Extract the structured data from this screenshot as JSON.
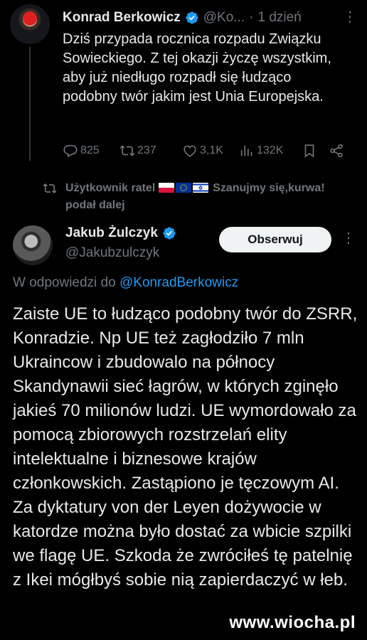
{
  "parent_tweet": {
    "author_name": "Konrad Berkowicz",
    "handle": "@Ko...",
    "separator": "·",
    "time": "1 dzień",
    "text": "Dziś przypada rocznica rozpadu Związku Sowieckiego. Z tej okazji życzę wszystkim, aby już niedługo rozpadł się łudząco podobny twór jakim jest Unia Europejska.",
    "replies": "825",
    "reposts": "237",
    "likes": "3,1K",
    "views": "132K"
  },
  "retweet_indicator": {
    "prefix": "Użytkownik ratel",
    "suffix": "Szanujmy się,kurwa!",
    "line2": "podał dalej",
    "flags": [
      "poland",
      "eu",
      "israel"
    ]
  },
  "main_tweet": {
    "author_name": "Jakub Żulczyk",
    "handle": "@Jakubzulczyk",
    "follow_label": "Obserwuj",
    "reply_prefix": "W odpowiedzi do",
    "reply_handle": "@KonradBerkowicz",
    "text": "Zaiste UE to łudząco podobny twór do ZSRR, Konradzie. Np UE też zagłodziło 7 mln Ukraincow i zbudowalo na północy Skandynawii sieć łagrów, w których zginęło jakieś 70 milionów ludzi. UE wymordowało za pomocą zbiorowych rozstrzelań elity intelektualne i biznesowe krajów członkowskich. Zastąpiono je tęczowym AI. Za dyktatury von der Leyen dożywocie w katordze można było dostać za wbicie szpilki we flagę UE. Szkoda że zwróciłeś tę patelnię z Ikei mógłbyś sobie nią zapierdaczyć w łeb."
  },
  "watermark": "www.wiocha.pl",
  "colors": {
    "background": "#000000",
    "text": "#e7e9ea",
    "muted": "#71767b",
    "link": "#1d9bf0",
    "verified": "#1d9bf0"
  }
}
